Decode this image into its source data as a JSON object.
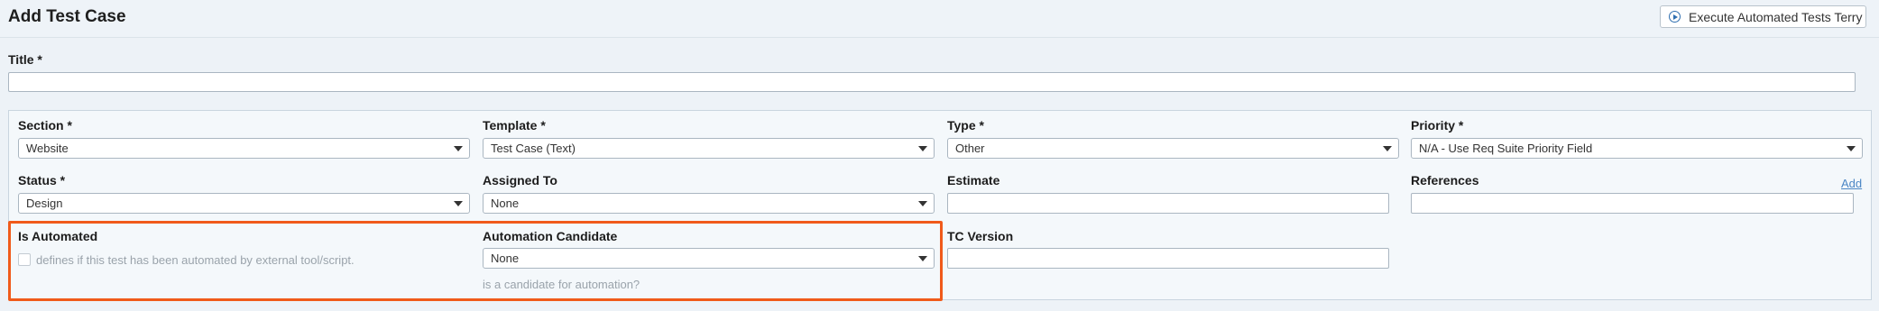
{
  "header": {
    "title": "Add Test Case",
    "execute_button": "Execute Automated Tests Terry"
  },
  "form": {
    "title": {
      "label": "Title *",
      "value": ""
    },
    "section": {
      "label": "Section *",
      "value": "Website"
    },
    "template": {
      "label": "Template *",
      "value": "Test Case (Text)"
    },
    "type": {
      "label": "Type *",
      "value": "Other"
    },
    "priority": {
      "label": "Priority *",
      "value": "N/A - Use Req Suite Priority Field"
    },
    "status": {
      "label": "Status *",
      "value": "Design"
    },
    "assigned_to": {
      "label": "Assigned To",
      "value": "None"
    },
    "estimate": {
      "label": "Estimate",
      "value": ""
    },
    "references": {
      "label": "References",
      "value": "",
      "add_link": "Add"
    },
    "is_automated": {
      "label": "Is Automated",
      "hint": "defines if this test has been automated by external tool/script.",
      "checked": false
    },
    "automation_candidate": {
      "label": "Automation Candidate",
      "value": "None",
      "hint": "is a candidate for automation?"
    },
    "tc_version": {
      "label": "TC Version",
      "value": ""
    }
  },
  "colors": {
    "highlight_border": "#f05a1a",
    "link": "#4a86c5"
  }
}
